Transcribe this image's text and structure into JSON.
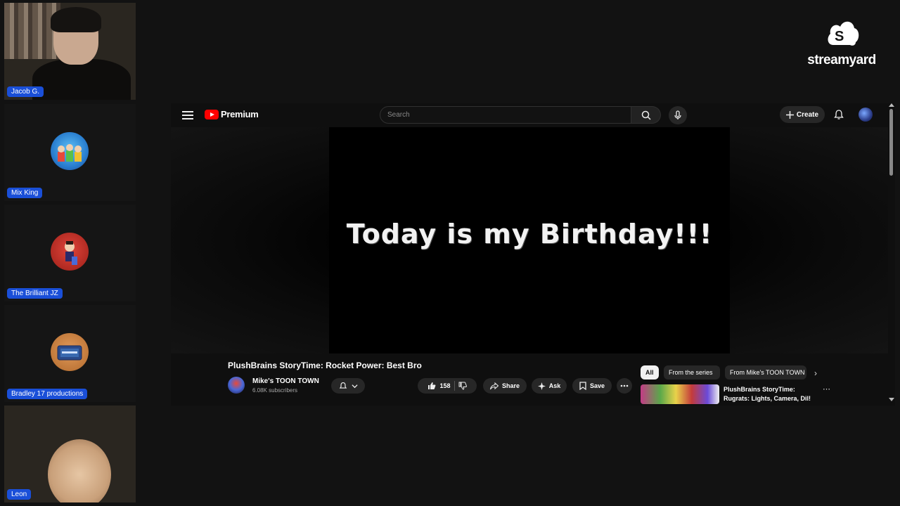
{
  "participants": [
    {
      "name": "Jacob G.",
      "kind": "camera"
    },
    {
      "name": "Mix King",
      "kind": "avatar",
      "avatar_color": "#3aa0e0"
    },
    {
      "name": "The Brilliant JZ",
      "kind": "avatar",
      "avatar_color": "#c0302a"
    },
    {
      "name": "Bradley 17 productions",
      "kind": "avatar",
      "avatar_color": "#c8763a"
    },
    {
      "name": "Leon",
      "kind": "camera"
    }
  ],
  "brand": {
    "logo_text": "streamyard"
  },
  "youtube": {
    "brand": "Premium",
    "search_placeholder": "Search",
    "create_label": "Create",
    "player_overlay_text": "Today is my Birthday!!!",
    "video_title": "PlushBrains StoryTime: Rocket Power: Best Bro",
    "channel_name": "Mike's TOON TOWN",
    "channel_subscribers": "6.08K subscribers",
    "like_count": "158",
    "share_label": "Share",
    "ask_label": "Ask",
    "save_label": "Save",
    "chips": [
      "All",
      "From the series",
      "From Mike's TOON TOWN"
    ],
    "recommendation_title": "PlushBrains StoryTime: Rugrats: Lights, Camera, Dil!"
  },
  "colors": {
    "name_tag": "#1a4fd8",
    "yt_red": "#ff0000",
    "background": "#121212"
  }
}
